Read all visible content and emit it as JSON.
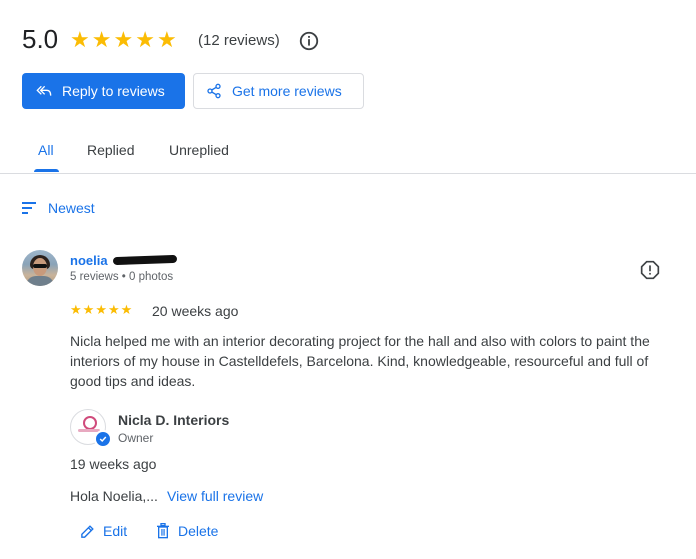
{
  "summary": {
    "rating": "5.0",
    "stars": 5,
    "review_count": "(12 reviews)"
  },
  "buttons": {
    "reply": "Reply to reviews",
    "get_more": "Get more reviews"
  },
  "tabs": [
    {
      "label": "All",
      "active": true
    },
    {
      "label": "Replied",
      "active": false
    },
    {
      "label": "Unreplied",
      "active": false
    }
  ],
  "sort": {
    "label": "Newest"
  },
  "review": {
    "reviewer_name": "noelia",
    "reviewer_meta": "5 reviews • 0 photos",
    "stars": 5,
    "time": "20 weeks ago",
    "text": "Nicla helped me with an interior decorating project for the hall and also with colors to paint the interiors of my house in Castelldefels, Barcelona. Kind, knowledgeable, resourceful and full of good tips and ideas.",
    "reply": {
      "owner_name": "Nicla D. Interiors",
      "owner_role": "Owner",
      "time": "19 weeks ago",
      "text": "Hola Noelia,...",
      "view_full": "View full review"
    },
    "actions": {
      "edit": "Edit",
      "delete": "Delete"
    }
  },
  "colors": {
    "accent": "#1a73e8",
    "star": "#fbbc04"
  }
}
